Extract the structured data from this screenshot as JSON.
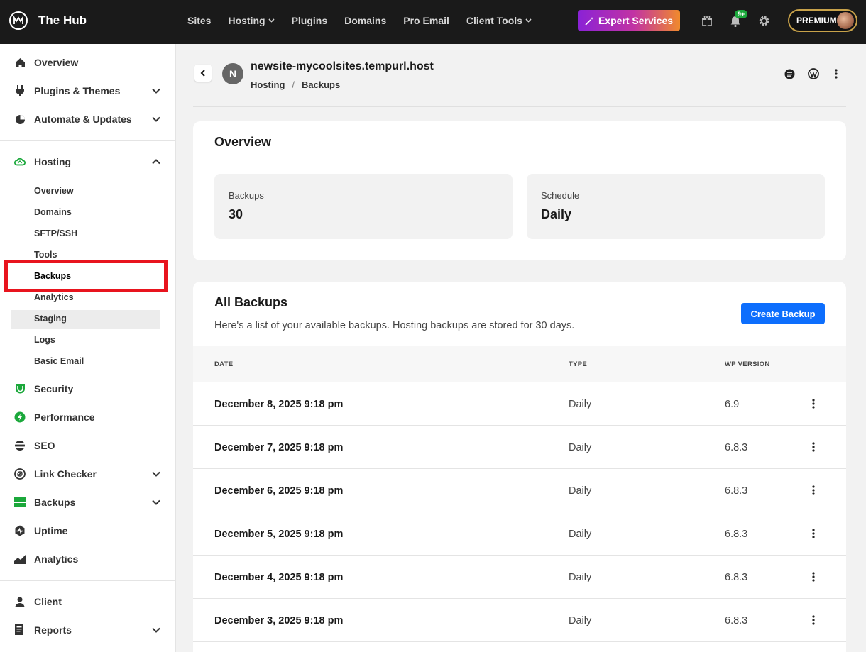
{
  "app": {
    "brand": "The Hub"
  },
  "topnav": [
    {
      "label": "Sites",
      "dropdown": false
    },
    {
      "label": "Hosting",
      "dropdown": true
    },
    {
      "label": "Plugins",
      "dropdown": false
    },
    {
      "label": "Domains",
      "dropdown": false
    },
    {
      "label": "Pro Email",
      "dropdown": false
    },
    {
      "label": "Client Tools",
      "dropdown": true
    }
  ],
  "expert_button": "Expert Services",
  "notification_badge": "9+",
  "premium_label": "PREMIUM",
  "sidebar": {
    "items": [
      {
        "label": "Overview",
        "icon": "home-icon"
      },
      {
        "label": "Plugins & Themes",
        "icon": "plug-icon"
      },
      {
        "label": "Automate & Updates",
        "icon": "automate-icon"
      },
      {
        "label": "Hosting",
        "icon": "cloud-icon"
      },
      {
        "label": "Security",
        "icon": "shield-icon"
      },
      {
        "label": "Performance",
        "icon": "bolt-icon"
      },
      {
        "label": "SEO",
        "icon": "seo-icon"
      },
      {
        "label": "Link Checker",
        "icon": "link-icon"
      },
      {
        "label": "Backups",
        "icon": "backups-icon"
      },
      {
        "label": "Uptime",
        "icon": "uptime-icon"
      },
      {
        "label": "Analytics",
        "icon": "analytics-icon"
      },
      {
        "label": "Client",
        "icon": "user-icon"
      },
      {
        "label": "Reports",
        "icon": "reports-icon"
      }
    ],
    "hosting_sub": [
      "Overview",
      "Domains",
      "SFTP/SSH",
      "Tools",
      "Backups",
      "Analytics",
      "Staging",
      "Logs",
      "Basic Email"
    ]
  },
  "site": {
    "avatar_letter": "N",
    "title": "newsite-mycoolsites.tempurl.host",
    "breadcrumb": [
      "Hosting",
      "Backups"
    ]
  },
  "overview": {
    "title": "Overview",
    "backups_label": "Backups",
    "backups_value": "30",
    "schedule_label": "Schedule",
    "schedule_value": "Daily"
  },
  "all_backups": {
    "title": "All Backups",
    "subtitle": "Here's a list of your available backups. Hosting backups are stored for 30 days.",
    "create_button": "Create Backup",
    "columns": [
      "DATE",
      "TYPE",
      "WP VERSION"
    ],
    "rows": [
      {
        "date": "December 8, 2025 9:18 pm",
        "type": "Daily",
        "version": "6.9"
      },
      {
        "date": "December 7, 2025 9:18 pm",
        "type": "Daily",
        "version": "6.8.3"
      },
      {
        "date": "December 6, 2025 9:18 pm",
        "type": "Daily",
        "version": "6.8.3"
      },
      {
        "date": "December 5, 2025 9:18 pm",
        "type": "Daily",
        "version": "6.8.3"
      },
      {
        "date": "December 4, 2025 9:18 pm",
        "type": "Daily",
        "version": "6.8.3"
      },
      {
        "date": "December 3, 2025 9:18 pm",
        "type": "Daily",
        "version": "6.8.3"
      }
    ]
  },
  "colors": {
    "accent_blue": "#0d6efd",
    "sidebar_green": "#1ba83b",
    "highlight_red": "#e8141e"
  }
}
